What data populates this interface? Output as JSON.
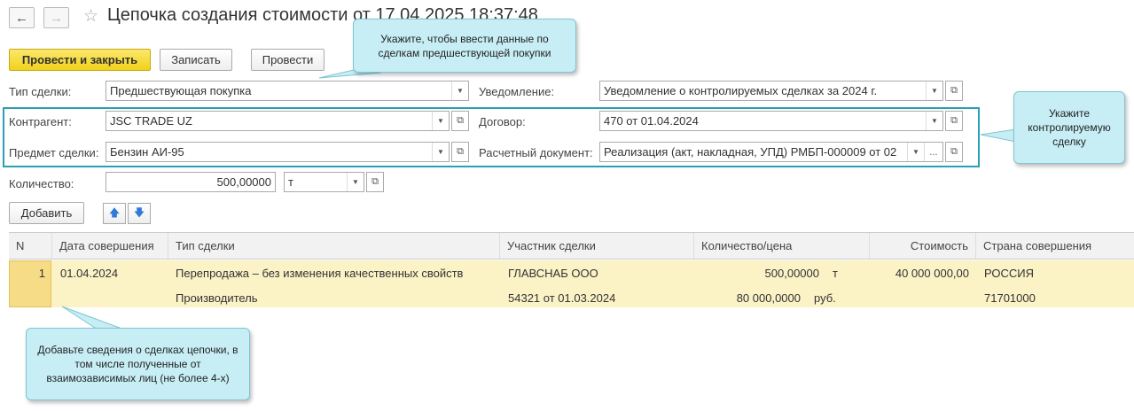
{
  "window": {
    "title": "Цепочка создания стоимости от 17.04.2025 18:37:48"
  },
  "nav": {
    "back_icon": "arrow-left-icon",
    "forward_icon": "arrow-right-icon",
    "favorite_icon": "star-icon"
  },
  "toolbar": {
    "post_close": "Провести и закрыть",
    "save": "Записать",
    "post": "Провести"
  },
  "form": {
    "deal_type": {
      "label": "Тип сделки:",
      "value": "Предшествующая покупка"
    },
    "notification": {
      "label": "Уведомление:",
      "value": "Уведомление о контролируемых сделках за 2024 г."
    },
    "counterparty": {
      "label": "Контрагент:",
      "value": "JSC TRADE UZ"
    },
    "contract": {
      "label": "Договор:",
      "value": "470 от 01.04.2024"
    },
    "subject": {
      "label": "Предмет сделки:",
      "value": "Бензин АИ-95"
    },
    "settlement_doc": {
      "label": "Расчетный документ:",
      "value": "Реализация (акт, накладная, УПД) РМБП-000009 от 02"
    },
    "quantity": {
      "label": "Количество:",
      "value": "500,00000",
      "unit": "т"
    }
  },
  "table_toolbar": {
    "add": "Добавить",
    "up_icon": "arrow-up-icon",
    "down_icon": "arrow-down-icon"
  },
  "table": {
    "headers": [
      "N",
      "Дата совершения",
      "Тип сделки",
      "Участник сделки",
      "Количество/цена",
      "Стоимость",
      "Страна совершения"
    ],
    "rows": [
      {
        "n": "1",
        "date": "01.04.2024",
        "type": "Перепродажа – без изменения качественных свойств",
        "type2": "Производитель",
        "participant": "ГЛАВСНАБ ООО",
        "participant2": "54321 от 01.03.2024",
        "qty": "500,00000",
        "qty_unit": "т",
        "price": "80 000,0000",
        "price_unit": "руб.",
        "cost": "40 000 000,00",
        "country": "РОССИЯ",
        "country_code": "71701000"
      }
    ]
  },
  "callouts": {
    "top": "Укажите, чтобы ввести данные по сделкам предшествующей покупки",
    "right": "Укажите контролируемую сделку",
    "bottom": "Добавьте сведения о сделках цепочки, в том числе полученные от взаимозависимых лиц (не более 4-х)"
  },
  "colors": {
    "accent_yellow": "#f1d21a",
    "teal_frame": "#2aa0b4",
    "callout_bg": "#c7eef5",
    "row_highlight": "#fbf2c6"
  }
}
